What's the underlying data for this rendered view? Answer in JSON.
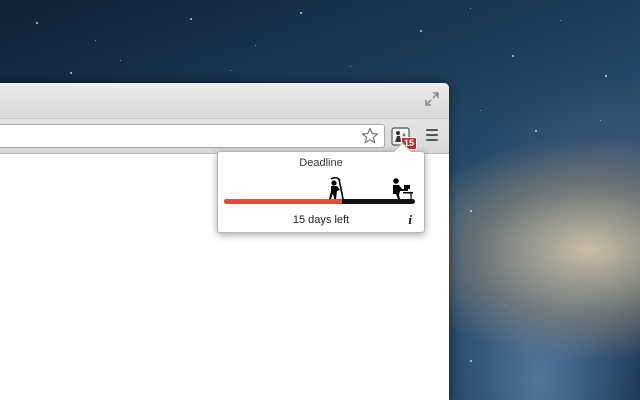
{
  "extension": {
    "badge_count": "15"
  },
  "popup": {
    "title": "Deadline",
    "remaining_text": "15 days left",
    "progress_elapsed": 0.62,
    "progress_color": "#e8473a",
    "track_color": "#111111",
    "info_icon": "i"
  },
  "icons": {
    "fullscreen": "fullscreen-icon",
    "bookmark": "bookmark-star-icon",
    "extension": "deadline-extension-icon",
    "menu": "hamburger-menu-icon",
    "reaper": "grim-reaper-icon",
    "worker": "person-at-desk-icon"
  }
}
